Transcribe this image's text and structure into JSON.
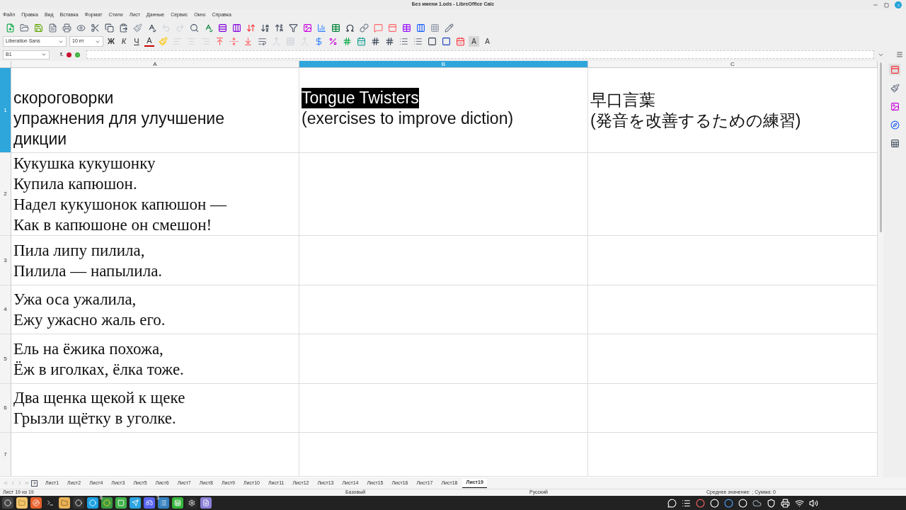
{
  "window": {
    "title": "Без имени 1.ods - LibreOffice Calc"
  },
  "menu": [
    "Файл",
    "Правка",
    "Вид",
    "Вставка",
    "Формат",
    "Стили",
    "Лист",
    "Данные",
    "Сервис",
    "Окно",
    "Справка"
  ],
  "formatting": {
    "font_name": "Liberation Sans",
    "font_size": "10 пт",
    "buttons": [
      {
        "kind": "bold",
        "label": "Ж",
        "selected": false
      },
      {
        "kind": "italic",
        "label": "К",
        "selected": false
      },
      {
        "kind": "underline",
        "label": "Ч",
        "selected": false
      },
      {
        "kind": "color",
        "label": "A",
        "selected": false
      }
    ],
    "shadow": {
      "label": "A",
      "selected": true
    },
    "outline": {
      "label": "A",
      "selected": false
    }
  },
  "formula_bar": {
    "name_box": "B1",
    "function_label": "f."
  },
  "columns": [
    {
      "label": "A",
      "selected": false
    },
    {
      "label": "B",
      "selected": true
    },
    {
      "label": "C",
      "selected": false
    }
  ],
  "rows": [
    {
      "number": "1",
      "selected": true,
      "cells": [
        {
          "lines": [
            {
              "text": "скороговорки",
              "selected": false
            },
            {
              "text": "упражнения для улучшение",
              "selected": false
            },
            {
              "text": "дикции",
              "selected": false
            }
          ]
        },
        {
          "lines": [
            {
              "text": "Tongue Twisters",
              "selected": true
            },
            {
              "text": "(exercises to improve diction)",
              "selected": false
            }
          ]
        },
        {
          "lines": [
            {
              "text": "早口言葉",
              "selected": false
            },
            {
              "text": "(発音を改善するための練習)",
              "selected": false
            }
          ]
        }
      ]
    },
    {
      "number": "2",
      "selected": false,
      "cells": [
        {
          "lines": [
            {
              "text": "Кукушка кукушонку",
              "selected": false
            },
            {
              "text": "Купила капюшон.",
              "selected": false
            },
            {
              "text": "Надел кукушонок капюшон —",
              "selected": false
            },
            {
              "text": "Как в капюшоне он смешон!",
              "selected": false
            }
          ]
        },
        {},
        {}
      ]
    },
    {
      "number": "3",
      "selected": false,
      "cells": [
        {
          "lines": [
            {
              "text": "Пила липу пилила,",
              "selected": false
            },
            {
              "text": "Пилила — напылила.",
              "selected": false
            }
          ]
        },
        {},
        {}
      ]
    },
    {
      "number": "4",
      "selected": false,
      "cells": [
        {
          "lines": [
            {
              "text": "Ужа оса ужалила,",
              "selected": false
            },
            {
              "text": "Ежу ужасно жаль его.",
              "selected": false
            }
          ]
        },
        {},
        {}
      ]
    },
    {
      "number": "5",
      "selected": false,
      "cells": [
        {
          "lines": [
            {
              "text": "Ель на ёжика похожа,",
              "selected": false
            },
            {
              "text": "Ёж в иголках, ёлка тоже.",
              "selected": false
            }
          ]
        },
        {},
        {}
      ]
    },
    {
      "number": "6",
      "selected": false,
      "cells": [
        {
          "lines": [
            {
              "text": "Два щенка щекой к щеке",
              "selected": false
            },
            {
              "text": "Грызли щётку в уголке.",
              "selected": false
            }
          ]
        },
        {},
        {}
      ]
    },
    {
      "number": "7",
      "selected": false,
      "cells": [
        {},
        {},
        {}
      ]
    }
  ],
  "sheet_tabs": [
    {
      "label": "Лист1",
      "selected": false
    },
    {
      "label": "Лист2",
      "selected": false
    },
    {
      "label": "Лист4",
      "selected": false
    },
    {
      "label": "Лист3",
      "selected": false
    },
    {
      "label": "Лист5",
      "selected": false
    },
    {
      "label": "Лист6",
      "selected": false
    },
    {
      "label": "Лист7",
      "selected": false
    },
    {
      "label": "Лист8",
      "selected": false
    },
    {
      "label": "Лист9",
      "selected": false
    },
    {
      "label": "Лист10",
      "selected": false
    },
    {
      "label": "Лист11",
      "selected": false
    },
    {
      "label": "Лист12",
      "selected": false
    },
    {
      "label": "Лист13",
      "selected": false
    },
    {
      "label": "Лист14",
      "selected": false
    },
    {
      "label": "Лист15",
      "selected": false
    },
    {
      "label": "Лист16",
      "selected": false
    },
    {
      "label": "Лист17",
      "selected": false
    },
    {
      "label": "Лист18",
      "selected": false
    },
    {
      "label": "Лист19",
      "selected": true
    }
  ],
  "status_bar": {
    "sheet": "Лист 19 из 19",
    "style": "Базовый",
    "language": "Русский",
    "summary": "Среднее значение: ; Сумма: 0"
  },
  "taskbar": {
    "badges": [
      {
        "text": "8"
      },
      {
        "text": "3"
      }
    ]
  }
}
